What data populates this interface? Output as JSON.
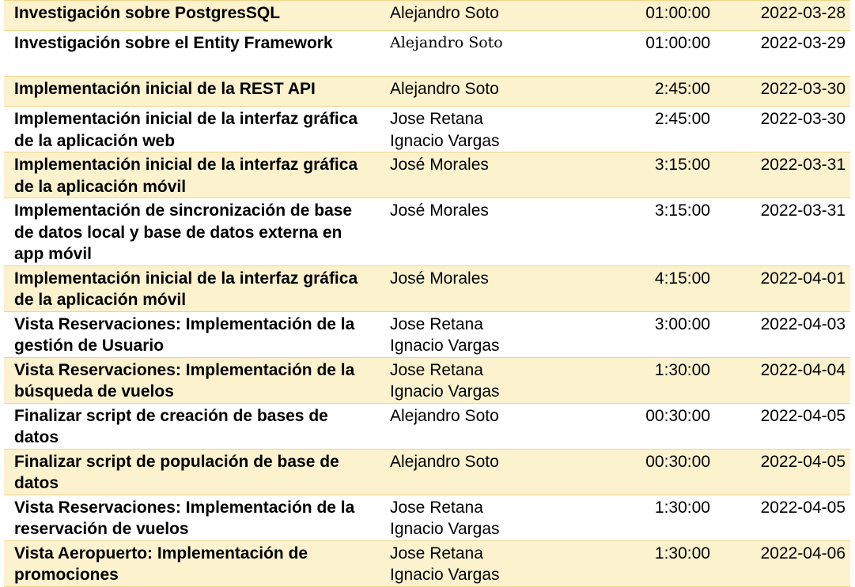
{
  "rows": [
    {
      "task": "Investigación sobre PostgresSQL",
      "responsible": [
        "Alejandro Soto"
      ],
      "time": "01:00:00",
      "date": "2022-03-28"
    },
    {
      "task": "Investigación sobre el Entity Framework",
      "responsible": [
        "Alejandro Soto"
      ],
      "time": "01:00:00",
      "date": "2022-03-29"
    },
    {
      "task": "Implementación inicial de la REST API",
      "responsible": [
        "Alejandro Soto"
      ],
      "time": "2:45:00",
      "date": "2022-03-30"
    },
    {
      "task": "Implementación inicial de la interfaz gráfica de la aplicación web",
      "responsible": [
        "Jose Retana",
        "Ignacio Vargas"
      ],
      "time": "2:45:00",
      "date": "2022-03-30"
    },
    {
      "task": "Implementación inicial de la interfaz gráfica de la aplicación móvil",
      "responsible": [
        "José Morales"
      ],
      "time": "3:15:00",
      "date": "2022-03-31"
    },
    {
      "task": "Implementación de sincronización de base de datos local y base de datos externa en app móvil",
      "responsible": [
        "José Morales"
      ],
      "time": "3:15:00",
      "date": "2022-03-31"
    },
    {
      "task": "Implementación inicial de la interfaz gráfica de la aplicación móvil",
      "responsible": [
        "José Morales"
      ],
      "time": "4:15:00",
      "date": "2022-04-01"
    },
    {
      "task": "Vista Reservaciones: Implementación de la gestión de Usuario",
      "responsible": [
        "Jose Retana",
        "Ignacio Vargas"
      ],
      "time": "3:00:00",
      "date": "2022-04-03"
    },
    {
      "task": "Vista Reservaciones: Implementación de la búsqueda de vuelos",
      "responsible": [
        "Jose Retana",
        "Ignacio Vargas"
      ],
      "time": "1:30:00",
      "date": "2022-04-04"
    },
    {
      "task": "Finalizar script de creación de bases de datos",
      "responsible": [
        "Alejandro Soto"
      ],
      "time": "00:30:00",
      "date": "2022-04-05"
    },
    {
      "task": "Finalizar script de populación de base de datos",
      "responsible": [
        "Alejandro Soto"
      ],
      "time": "00:30:00",
      "date": "2022-04-05"
    },
    {
      "task": "Vista Reservaciones: Implementación de la reservación de vuelos",
      "responsible": [
        "Jose Retana",
        "Ignacio Vargas"
      ],
      "time": "1:30:00",
      "date": "2022-04-05"
    },
    {
      "task": "Vista Aeropuerto: Implementación de promociones",
      "responsible": [
        "Jose Retana",
        "Ignacio Vargas"
      ],
      "time": "1:30:00",
      "date": "2022-04-06"
    }
  ]
}
